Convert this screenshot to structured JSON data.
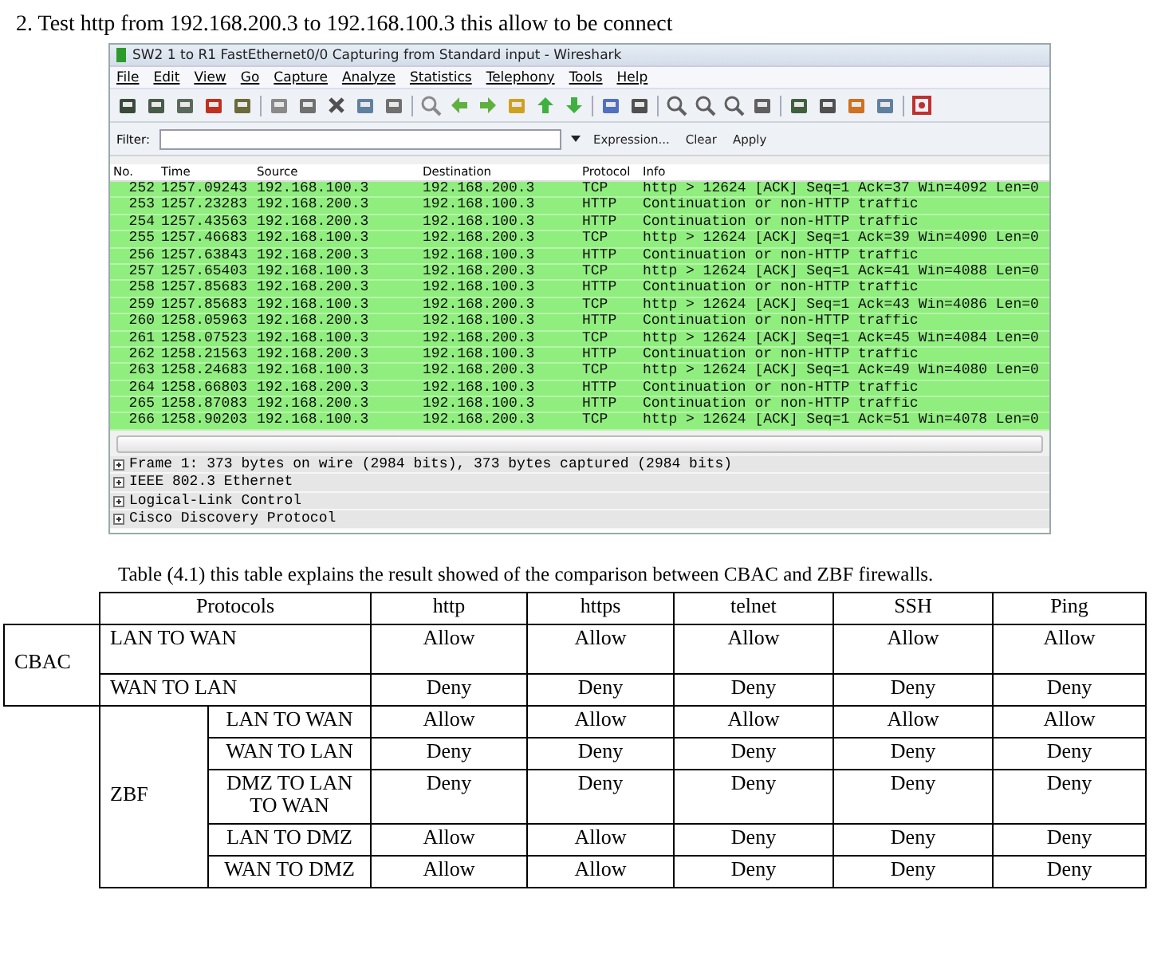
{
  "heading": "2. Test http from 192.168.200.3 to 192.168.100.3 this allow to be connect",
  "wireshark": {
    "title": "SW2 1 to R1 FastEthernet0/0 Capturing from Standard input - Wireshark",
    "menu": [
      "File",
      "Edit",
      "View",
      "Go",
      "Capture",
      "Analyze",
      "Statistics",
      "Telephony",
      "Tools",
      "Help"
    ],
    "filter": {
      "label": "Filter:",
      "buttons": [
        "Expression...",
        "Clear",
        "Apply"
      ]
    },
    "columns": [
      "No.",
      "Time",
      "Source",
      "Destination",
      "Protocol",
      "Info"
    ],
    "packets": [
      {
        "no": "252",
        "time": "1257.09243",
        "source": "192.168.100.3",
        "destination": "192.168.200.3",
        "protocol": "TCP",
        "info": "http > 12624 [ACK] Seq=1 Ack=37 Win=4092 Len=0"
      },
      {
        "no": "253",
        "time": "1257.23283",
        "source": "192.168.200.3",
        "destination": "192.168.100.3",
        "protocol": "HTTP",
        "info": "Continuation or non-HTTP traffic"
      },
      {
        "no": "254",
        "time": "1257.43563",
        "source": "192.168.200.3",
        "destination": "192.168.100.3",
        "protocol": "HTTP",
        "info": "Continuation or non-HTTP traffic"
      },
      {
        "no": "255",
        "time": "1257.46683",
        "source": "192.168.100.3",
        "destination": "192.168.200.3",
        "protocol": "TCP",
        "info": "http > 12624 [ACK] Seq=1 Ack=39 Win=4090 Len=0"
      },
      {
        "no": "256",
        "time": "1257.63843",
        "source": "192.168.200.3",
        "destination": "192.168.100.3",
        "protocol": "HTTP",
        "info": "Continuation or non-HTTP traffic"
      },
      {
        "no": "257",
        "time": "1257.65403",
        "source": "192.168.100.3",
        "destination": "192.168.200.3",
        "protocol": "TCP",
        "info": "http > 12624 [ACK] Seq=1 Ack=41 Win=4088 Len=0"
      },
      {
        "no": "258",
        "time": "1257.85683",
        "source": "192.168.200.3",
        "destination": "192.168.100.3",
        "protocol": "HTTP",
        "info": "Continuation or non-HTTP traffic"
      },
      {
        "no": "259",
        "time": "1257.85683",
        "source": "192.168.100.3",
        "destination": "192.168.200.3",
        "protocol": "TCP",
        "info": "http > 12624 [ACK] Seq=1 Ack=43 Win=4086 Len=0"
      },
      {
        "no": "260",
        "time": "1258.05963",
        "source": "192.168.200.3",
        "destination": "192.168.100.3",
        "protocol": "HTTP",
        "info": "Continuation or non-HTTP traffic"
      },
      {
        "no": "261",
        "time": "1258.07523",
        "source": "192.168.100.3",
        "destination": "192.168.200.3",
        "protocol": "TCP",
        "info": "http > 12624 [ACK] Seq=1 Ack=45 Win=4084 Len=0"
      },
      {
        "no": "262",
        "time": "1258.21563",
        "source": "192.168.200.3",
        "destination": "192.168.100.3",
        "protocol": "HTTP",
        "info": "Continuation or non-HTTP traffic"
      },
      {
        "no": "263",
        "time": "1258.24683",
        "source": "192.168.100.3",
        "destination": "192.168.200.3",
        "protocol": "TCP",
        "info": "http > 12624 [ACK] Seq=1 Ack=49 Win=4080 Len=0"
      },
      {
        "no": "264",
        "time": "1258.66803",
        "source": "192.168.200.3",
        "destination": "192.168.100.3",
        "protocol": "HTTP",
        "info": "Continuation or non-HTTP traffic"
      },
      {
        "no": "265",
        "time": "1258.87083",
        "source": "192.168.200.3",
        "destination": "192.168.100.3",
        "protocol": "HTTP",
        "info": "Continuation or non-HTTP traffic"
      },
      {
        "no": "266",
        "time": "1258.90203",
        "source": "192.168.100.3",
        "destination": "192.168.200.3",
        "protocol": "TCP",
        "info": "http > 12624 [ACK] Seq=1 Ack=51 Win=4078 Len=0"
      }
    ],
    "details": [
      {
        "text": "Frame 1: 373 bytes on wire (2984 bits), 373 bytes captured (2984 bits)",
        "expanded": false
      },
      {
        "text": "IEEE 802.3 Ethernet",
        "expanded": false
      },
      {
        "text": "Logical-Link Control",
        "expanded": false
      },
      {
        "text": "Cisco Discovery Protocol",
        "expanded": false
      }
    ]
  },
  "table_caption": "Table (4.1) this table explains the result showed of the comparison between CBAC and ZBF firewalls.",
  "table": {
    "header": {
      "label": "Protocols",
      "columns": [
        "http",
        "https",
        "telnet",
        "SSH",
        "Ping"
      ]
    },
    "groups": [
      {
        "name": "CBAC",
        "kind": "wide",
        "rows": [
          {
            "label": "LAN TO WAN",
            "values": [
              "Allow",
              "Allow",
              "Allow",
              "Allow",
              "Allow"
            ]
          },
          {
            "label": "WAN TO LAN",
            "values": [
              "Deny",
              "Deny",
              "Deny",
              "Deny",
              "Deny"
            ]
          }
        ]
      },
      {
        "name": "ZBF",
        "kind": "indented",
        "rows": [
          {
            "label": "LAN TO WAN",
            "values": [
              "Allow",
              "Allow",
              "Allow",
              "Allow",
              "Allow"
            ]
          },
          {
            "label": "WAN TO LAN",
            "values": [
              "Deny",
              "Deny",
              "Deny",
              "Deny",
              "Deny"
            ]
          },
          {
            "label": "DMZ TO LAN TO WAN",
            "values": [
              "Deny",
              "Deny",
              "Deny",
              "Deny",
              "Deny"
            ]
          },
          {
            "label": "LAN TO DMZ",
            "values": [
              "Allow",
              "Allow",
              "Deny",
              "Deny",
              "Deny"
            ]
          },
          {
            "label": "WAN TO DMZ",
            "values": [
              "Allow",
              "Allow",
              "Deny",
              "Deny",
              "Deny"
            ]
          }
        ]
      }
    ]
  }
}
